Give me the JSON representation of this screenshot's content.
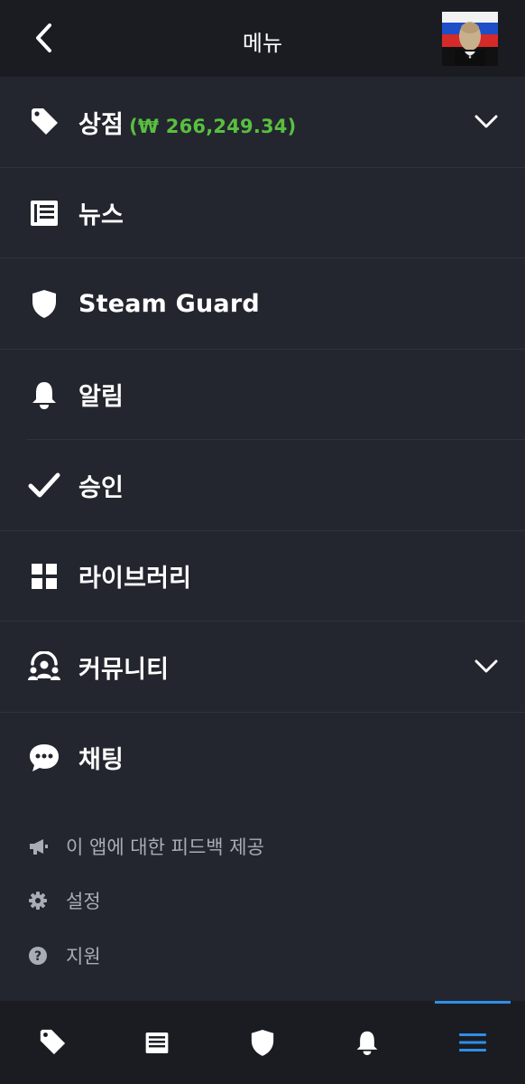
{
  "header": {
    "title": "메뉴",
    "back_icon": "chevron-left-icon",
    "avatar": "user-avatar"
  },
  "menu": {
    "items": [
      {
        "label": "상점",
        "icon": "tag-icon",
        "balance": "(₩ 266,249.34)",
        "expandable": true
      },
      {
        "label": "뉴스",
        "icon": "newspaper-icon"
      },
      {
        "label": "Steam Guard",
        "icon": "shield-icon"
      },
      {
        "label": "알림",
        "icon": "bell-icon"
      },
      {
        "label": "승인",
        "icon": "checkmark-icon"
      },
      {
        "label": "라이브러리",
        "icon": "grid-icon"
      },
      {
        "label": "커뮤니티",
        "icon": "community-icon",
        "expandable": true
      },
      {
        "label": "채팅",
        "icon": "chat-icon"
      }
    ]
  },
  "secondary": {
    "items": [
      {
        "label": "이 앱에 대한 피드백 제공",
        "icon": "megaphone-icon"
      },
      {
        "label": "설정",
        "icon": "gear-icon"
      },
      {
        "label": "지원",
        "icon": "help-icon"
      }
    ]
  },
  "tabbar": {
    "tabs": [
      {
        "icon": "tag-icon"
      },
      {
        "icon": "newspaper-icon"
      },
      {
        "icon": "shield-icon"
      },
      {
        "icon": "bell-icon"
      },
      {
        "icon": "menu-icon",
        "active": true
      }
    ]
  },
  "colors": {
    "background": "#23262e",
    "header": "#1a1c22",
    "balance": "#59bf40",
    "secondary_text": "#a8adb5",
    "accent": "#2f8fe8"
  }
}
